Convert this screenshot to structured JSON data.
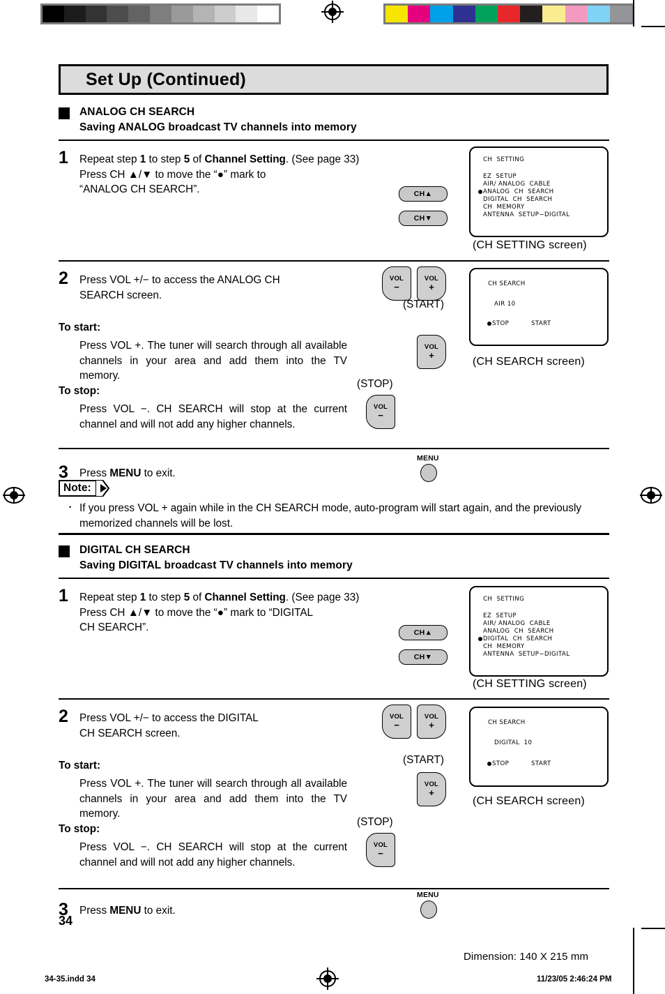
{
  "document": {
    "title": "Set Up (Continued)",
    "page_number": "34",
    "dimension_note": "Dimension: 140  X 215 mm",
    "footer_left": "34-35.indd   34",
    "footer_right": "11/23/05   2:46:24 PM"
  },
  "analog_section": {
    "heading": "ANALOG CH SEARCH",
    "subheading": "Saving ANALOG broadcast TV channels into memory",
    "step1": {
      "number": "1",
      "line1_a": "Repeat step ",
      "line1_b": "1",
      "line1_c": " to step ",
      "line1_d": "5",
      "line1_e": " of ",
      "line1_f": "Channel Setting",
      "line1_g": ". (See page 33)",
      "line2": "Press  CH  ▲/▼  to  move  the  “●”  mark  to",
      "line3": "“ANALOG CH SEARCH”.",
      "button_up": "CH▲",
      "button_down": "CH▼"
    },
    "step2": {
      "number": "2",
      "line1": "Press  VOL  +/−  to  access  the  ANALOG  CH",
      "line2": "SEARCH screen.",
      "to_start_label": "To start:",
      "to_start_text": "Press VOL +. The tuner will search through all available channels in your area and add them into the TV memory.",
      "to_stop_label": "To stop:",
      "to_stop_text": "Press VOL −. CH SEARCH will stop at the current channel and will not add any higher channels.",
      "start_caption": "(START)",
      "stop_caption": "(STOP)",
      "vol_minus": "VOL",
      "vol_minus_sign": "−",
      "vol_plus": "VOL",
      "vol_plus_sign": "+"
    },
    "step3": {
      "number": "3",
      "text": "Press MENU to exit.",
      "menu_label": "MENU"
    },
    "note": {
      "label": "Note:",
      "bullet": "•",
      "text": "If you press VOL + again while in the CH SEARCH mode, auto-program will start again, and the previously memorized channels will be lost."
    },
    "ch_setting_screen": {
      "title": "CH  SETTING",
      "items": [
        "EZ  SETUP",
        "AIR/ ANALOG  CABLE",
        "ANALOG  CH  SEARCH",
        "DIGITAL  CH  SEARCH",
        "CH  MEMORY",
        "ANTENNA  SETUP−DIGITAL"
      ],
      "selected_index": 2,
      "caption": "(CH SETTING screen)"
    },
    "ch_search_screen": {
      "title": "CH SEARCH",
      "channel": "AIR 10",
      "stop_label": "STOP",
      "start_label": "START",
      "selected": "STOP",
      "caption": "(CH SEARCH screen)"
    }
  },
  "digital_section": {
    "heading": "DIGITAL CH SEARCH",
    "subheading": "Saving DIGITAL broadcast TV channels into memory",
    "step1": {
      "number": "1",
      "line1_a": "Repeat step ",
      "line1_b": "1",
      "line1_c": " to step ",
      "line1_d": "5",
      "line1_e": " of ",
      "line1_f": "Channel Setting",
      "line1_g": ". (See page 33)",
      "line2": "Press CH ▲/▼ to move the “●” mark to “DIGITAL",
      "line3": "CH SEARCH”.",
      "button_up": "CH▲",
      "button_down": "CH▼"
    },
    "step2": {
      "number": "2",
      "line1": "Press VOL +/− to access the DIGITAL",
      "line2": "CH SEARCH screen.",
      "to_start_label": "To start:",
      "to_start_text": "Press VOL +. The tuner will search through all available channels in your area and add them into the TV memory.",
      "to_stop_label": "To stop:",
      "to_stop_text": "Press VOL −. CH SEARCH will stop at the current channel and will not add any higher channels.",
      "start_caption": "(START)",
      "stop_caption": "(STOP)",
      "vol_minus": "VOL",
      "vol_minus_sign": "−",
      "vol_plus": "VOL",
      "vol_plus_sign": "+"
    },
    "step3": {
      "number": "3",
      "text": "Press MENU to exit.",
      "menu_label": "MENU"
    },
    "ch_setting_screen": {
      "title": "CH  SETTING",
      "items": [
        "EZ  SETUP",
        "AIR/ ANALOG  CABLE",
        "ANALOG  CH  SEARCH",
        "DIGITAL  CH  SEARCH",
        "CH  MEMORY",
        "ANTENNA  SETUP−DIGITAL"
      ],
      "selected_index": 3,
      "caption": "(CH SETTING screen)"
    },
    "ch_search_screen": {
      "title": "CH SEARCH",
      "channel": "DIGITAL  10",
      "stop_label": "STOP",
      "start_label": "START",
      "selected": "STOP",
      "caption": "(CH SEARCH screen)"
    }
  },
  "calibration": {
    "grayscale": [
      "#000000",
      "#1c1c1c",
      "#333333",
      "#4d4d4d",
      "#636363",
      "#7e7e7e",
      "#9a9a9a",
      "#b4b4b4",
      "#cdcdcd",
      "#e8e8e8",
      "#ffffff"
    ],
    "colors": [
      "#f6e500",
      "#e6007e",
      "#00a0e9",
      "#2e3192",
      "#00a15a",
      "#e8272a",
      "#231f20",
      "#faed91",
      "#f49ac1",
      "#7fd4f5",
      "#939598"
    ]
  }
}
